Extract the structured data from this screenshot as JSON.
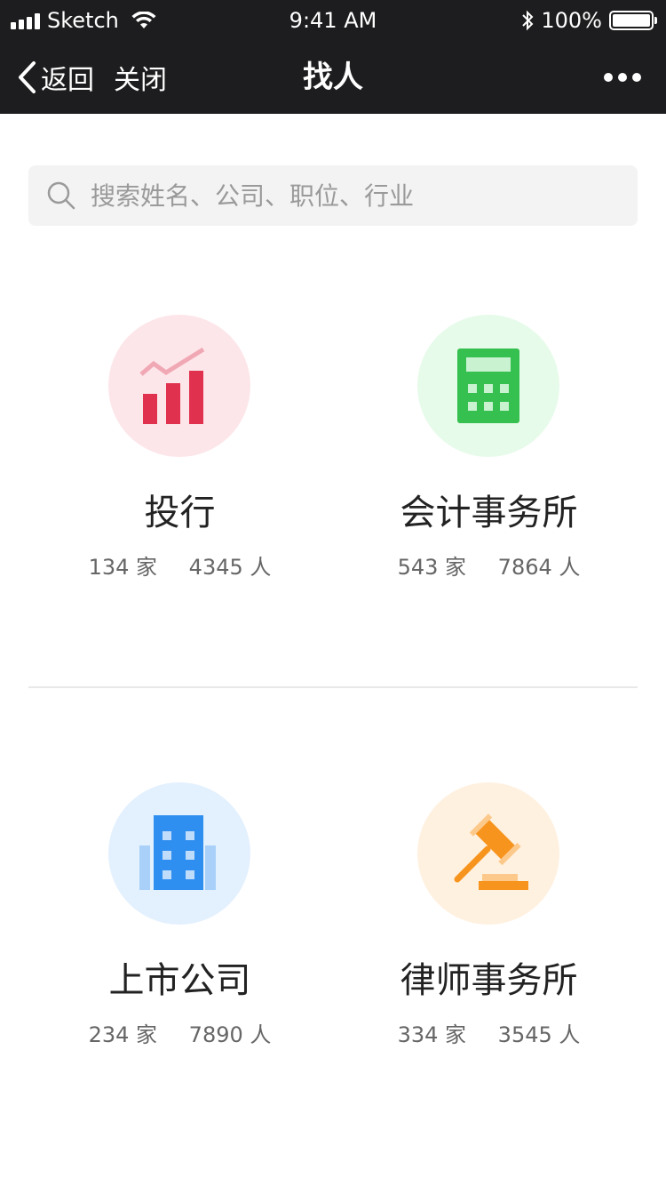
{
  "status_bar": {
    "carrier": "Sketch",
    "time": "9:41 AM",
    "battery": "100%"
  },
  "nav": {
    "back_label": "返回",
    "close_label": "关闭",
    "title": "找人"
  },
  "search": {
    "placeholder": "搜索姓名、公司、职位、行业"
  },
  "categories": [
    {
      "title": "投行",
      "companies": "134 家",
      "people": "4345 人",
      "icon": "chart-icon",
      "color": "#e0324f",
      "bg": "#fde6ea"
    },
    {
      "title": "会计事务所",
      "companies": "543 家",
      "people": "7864 人",
      "icon": "calculator-icon",
      "color": "#35c04f",
      "bg": "#e7fbea"
    },
    {
      "title": "上市公司",
      "companies": "234 家",
      "people": "7890 人",
      "icon": "building-icon",
      "color": "#2f8ff0",
      "bg": "#e3f0fe"
    },
    {
      "title": "律师事务所",
      "companies": "334 家",
      "people": "3545 人",
      "icon": "gavel-icon",
      "color": "#f7941d",
      "bg": "#fff1e0"
    }
  ]
}
